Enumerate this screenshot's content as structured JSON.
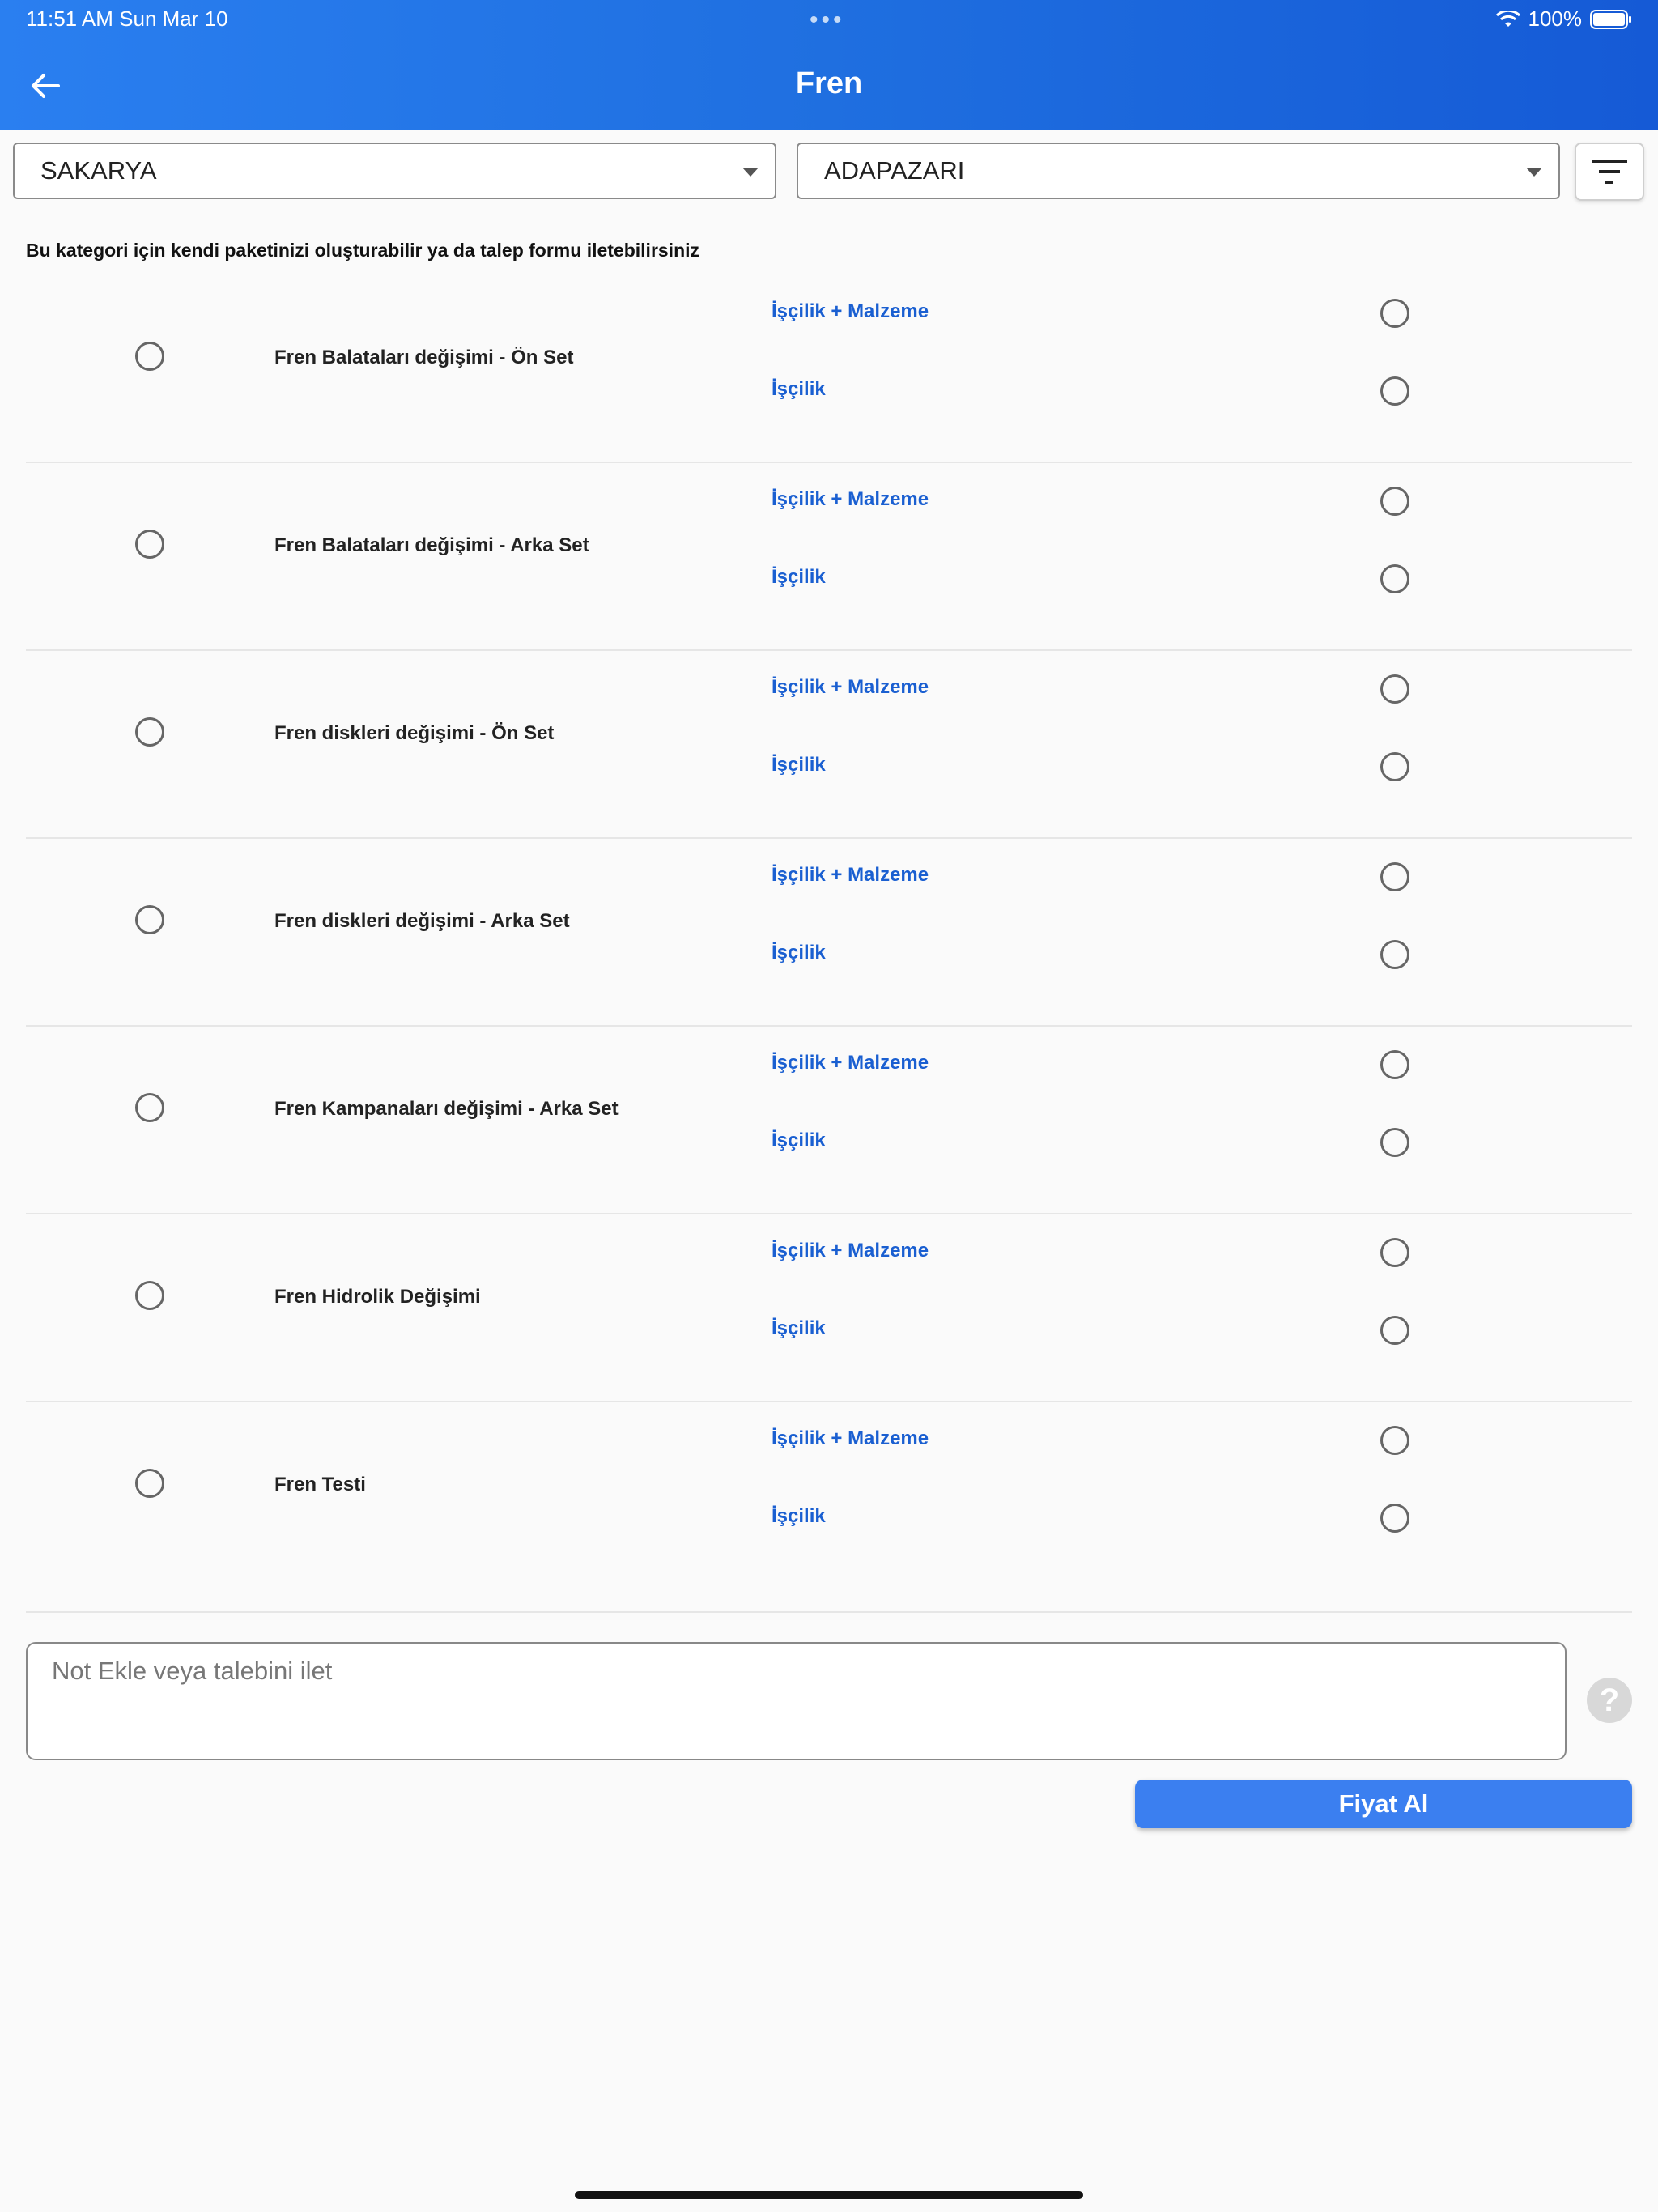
{
  "status_bar": {
    "time": "11:51 AM   Sun Mar 10",
    "dots": "•••",
    "battery": "100%"
  },
  "header": {
    "title": "Fren",
    "back_icon": "arrow-left-icon"
  },
  "filters": {
    "city": "SAKARYA",
    "district": "ADAPAZARI",
    "filter_icon": "filter-icon"
  },
  "info_text": "Bu kategori için kendi paketinizi oluşturabilir ya da talep formu iletebilirsiniz",
  "services": [
    {
      "name": "Fren Balataları değişimi - Ön Set",
      "option1": "İşçilik + Malzeme",
      "option2": "İşçilik"
    },
    {
      "name": "Fren Balataları değişimi - Arka Set",
      "option1": "İşçilik + Malzeme",
      "option2": "İşçilik"
    },
    {
      "name": "Fren diskleri değişimi - Ön Set",
      "option1": "İşçilik + Malzeme",
      "option2": "İşçilik"
    },
    {
      "name": "Fren diskleri değişimi - Arka Set",
      "option1": "İşçilik + Malzeme",
      "option2": "İşçilik"
    },
    {
      "name": "Fren Kampanaları değişimi - Arka Set",
      "option1": "İşçilik + Malzeme",
      "option2": "İşçilik"
    },
    {
      "name": "Fren Hidrolik Değişimi",
      "option1": "İşçilik + Malzeme",
      "option2": "İşçilik"
    },
    {
      "name": "Fren Testi",
      "option1": "İşçilik + Malzeme",
      "option2": "İşçilik"
    }
  ],
  "note": {
    "placeholder": "Not Ekle veya talebini ilet",
    "help_symbol": "?"
  },
  "submit_label": "Fiyat Al",
  "colors": {
    "header_start": "#2a7ff0",
    "header_end": "#155ad6",
    "option_text": "#1a5fd1",
    "button": "#3b7ff0"
  }
}
